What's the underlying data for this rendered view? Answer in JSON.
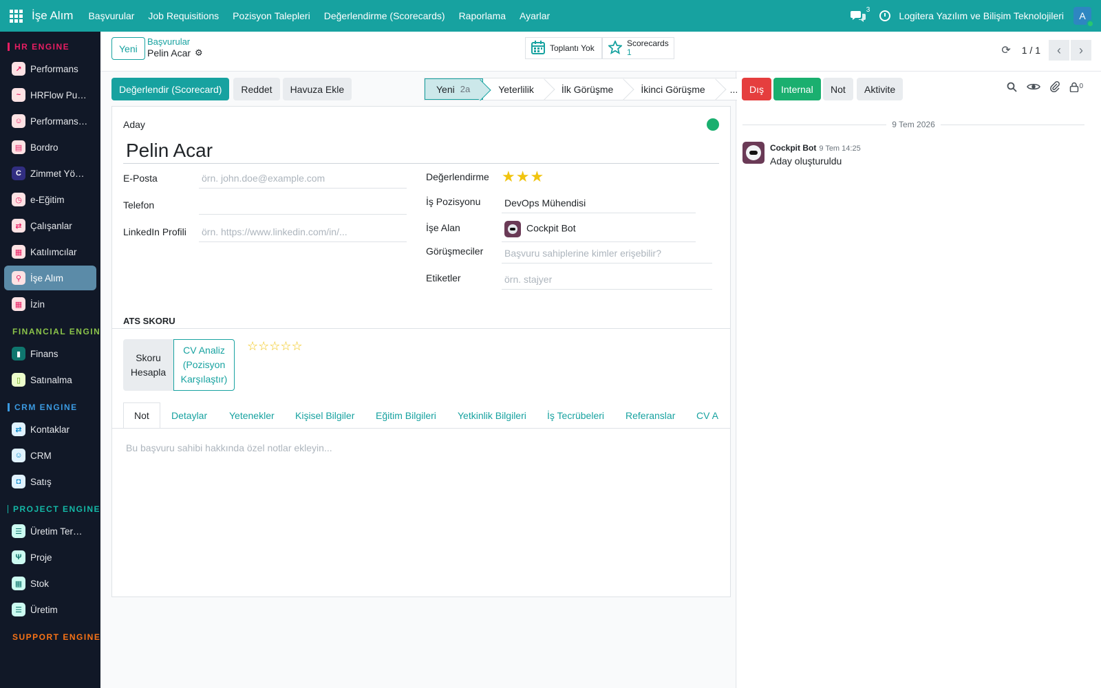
{
  "topbar": {
    "app_name": "İşe Alım",
    "menu": [
      "Başvurular",
      "Job Requisitions",
      "Pozisyon Talepleri",
      "Değerlendirme (Scorecards)",
      "Raporlama",
      "Ayarlar"
    ],
    "chat_count": "3",
    "company": "Logitera Yazılım ve Bilişim Teknolojileri",
    "user_initial": "A"
  },
  "sidebar": {
    "sections": [
      {
        "title": "HR ENGINE",
        "color": "#e91e63",
        "items": [
          {
            "label": "Performans",
            "icon": "trend-icon",
            "glyph": "↗",
            "icon_bg": "#fde2e4",
            "icon_fg": "#e91e63"
          },
          {
            "label": "HRFlow Pulse",
            "icon": "pulse-icon",
            "glyph": "~",
            "icon_bg": "#fde2e4",
            "icon_fg": "#e91e63"
          },
          {
            "label": "Performans …",
            "icon": "person-icon",
            "glyph": "☺",
            "icon_bg": "#fde2e4",
            "icon_fg": "#e91e63"
          },
          {
            "label": "Bordro",
            "icon": "payroll-icon",
            "glyph": "▤",
            "icon_bg": "#fde2e4",
            "icon_fg": "#e91e63"
          },
          {
            "label": "Zimmet Yön…",
            "icon": "c-letter-icon",
            "glyph": "C",
            "icon_bg": "#312e81",
            "icon_fg": "#ffffff"
          },
          {
            "label": "e-Eğitim",
            "icon": "clock-icon",
            "glyph": "◷",
            "icon_bg": "#fde2e4",
            "icon_fg": "#e91e63"
          },
          {
            "label": "Çalışanlar",
            "icon": "swap-icon",
            "glyph": "⇄",
            "icon_bg": "#fde2e4",
            "icon_fg": "#e91e63"
          },
          {
            "label": "Katılımcılar",
            "icon": "calendar-icon",
            "glyph": "▦",
            "icon_bg": "#fde2e4",
            "icon_fg": "#e91e63"
          },
          {
            "label": "İşe Alım",
            "icon": "search-person-icon",
            "glyph": "⚲",
            "icon_bg": "#fde2e4",
            "icon_fg": "#e91e63",
            "active": true
          },
          {
            "label": "İzin",
            "icon": "calendar-icon",
            "glyph": "▦",
            "icon_bg": "#fde2e4",
            "icon_fg": "#e91e63"
          }
        ]
      },
      {
        "title": "FINANCIAL ENGINE",
        "color": "#8bc34a",
        "items": [
          {
            "label": "Finans",
            "icon": "bar-chart-icon",
            "glyph": "▮",
            "icon_bg": "#0f766e",
            "icon_fg": "#ffffff"
          },
          {
            "label": "Satınalma",
            "icon": "doc-icon",
            "glyph": "▯",
            "icon_bg": "#ecfccb",
            "icon_fg": "#65a30d"
          }
        ]
      },
      {
        "title": "CRM ENGINE",
        "color": "#3b9ae1",
        "items": [
          {
            "label": "Kontaklar",
            "icon": "swap-icon",
            "glyph": "⇄",
            "icon_bg": "#e0f2fe",
            "icon_fg": "#0284c7"
          },
          {
            "label": "CRM",
            "icon": "person-icon",
            "glyph": "☺",
            "icon_bg": "#e0f2fe",
            "icon_fg": "#0284c7"
          },
          {
            "label": "Satış",
            "icon": "bag-icon",
            "glyph": "◘",
            "icon_bg": "#e0f2fe",
            "icon_fg": "#0284c7"
          }
        ]
      },
      {
        "title": "PROJECT ENGINE",
        "color": "#14b8a6",
        "items": [
          {
            "label": "Üretim Term…",
            "icon": "list-icon",
            "glyph": "☰",
            "icon_bg": "#ccfbf1",
            "icon_fg": "#0f766e"
          },
          {
            "label": "Proje",
            "icon": "puzzle-icon",
            "glyph": "Ψ",
            "icon_bg": "#ccfbf1",
            "icon_fg": "#0f766e"
          },
          {
            "label": "Stok",
            "icon": "calendar-icon",
            "glyph": "▦",
            "icon_bg": "#ccfbf1",
            "icon_fg": "#0f766e"
          },
          {
            "label": "Üretim",
            "icon": "list-icon",
            "glyph": "☰",
            "icon_bg": "#ccfbf1",
            "icon_fg": "#0f766e"
          }
        ]
      },
      {
        "title": "SUPPORT ENGINE",
        "color": "#f97316",
        "items": []
      }
    ]
  },
  "control": {
    "new_label": "Yeni",
    "breadcrumb_parent": "Başvurular",
    "breadcrumb_current": "Pelin Acar",
    "meetings_label": "Toplantı Yok",
    "scorecards_label": "Scorecards",
    "scorecards_count": "1",
    "pager": "1 / 1"
  },
  "actions": [
    "Değerlendir (Scorecard)",
    "Reddet",
    "Havuza Ekle"
  ],
  "stages": [
    {
      "label": "Yeni",
      "count": "2a",
      "current": true
    },
    {
      "label": "Yeterlilik"
    },
    {
      "label": "İlk Görüşme"
    },
    {
      "label": "İkinci Görüşme"
    },
    {
      "label": "..."
    }
  ],
  "form": {
    "candidate_label": "Aday",
    "candidate_name": "Pelin Acar",
    "email_label": "E-Posta",
    "email_placeholder": "örn. john.doe@example.com",
    "phone_label": "Telefon",
    "linkedin_label": "LinkedIn Profili",
    "linkedin_placeholder": "örn. https://www.linkedin.com/in/...",
    "rating_label": "Değerlendirme",
    "rating_value": 3,
    "rating_max": 3,
    "position_label": "İş Pozisyonu",
    "position_value": "DevOps Mühendisi",
    "recruiter_label": "İşe Alan",
    "recruiter_value": "Cockpit Bot",
    "interviewers_label": "Görüşmeciler",
    "interviewers_placeholder": "Başvuru sahiplerine kimler erişebilir?",
    "tags_label": "Etiketler",
    "tags_placeholder": "örn. stajyer",
    "ats_title": "ATS SKORU",
    "score_button": "Skoru Hesapla",
    "cv_button": "CV Analiz (Pozisyon Karşılaştır)",
    "ats_stars": "☆☆☆☆☆",
    "tabs": [
      "Not",
      "Detaylar",
      "Yetenekler",
      "Kişisel Bilgiler",
      "Eğitim Bilgileri",
      "Yetkinlik Bilgileri",
      "İş Tecrübeleri",
      "Referanslar",
      "CV A"
    ],
    "note_placeholder": "Bu başvuru sahibi hakkında özel notlar ekleyin..."
  },
  "chatter": {
    "buttons": [
      {
        "label": "Dış",
        "bg": "#e53e3e",
        "fg": "#ffffff"
      },
      {
        "label": "Internal",
        "bg": "#1aaf6f",
        "fg": "#ffffff"
      },
      {
        "label": "Not",
        "bg": "#e9ecef",
        "fg": "#212529"
      },
      {
        "label": "Aktivite",
        "bg": "#e9ecef",
        "fg": "#212529"
      }
    ],
    "followers_count": "0",
    "date": "9 Tem 2026",
    "message": {
      "author": "Cockpit Bot",
      "time": "9 Tem 14:25",
      "body": "Aday oluşturuldu"
    }
  },
  "colors": {
    "primary": "#17a2a0",
    "sidebar_bg": "#111827",
    "stars": "#f1c40f"
  }
}
